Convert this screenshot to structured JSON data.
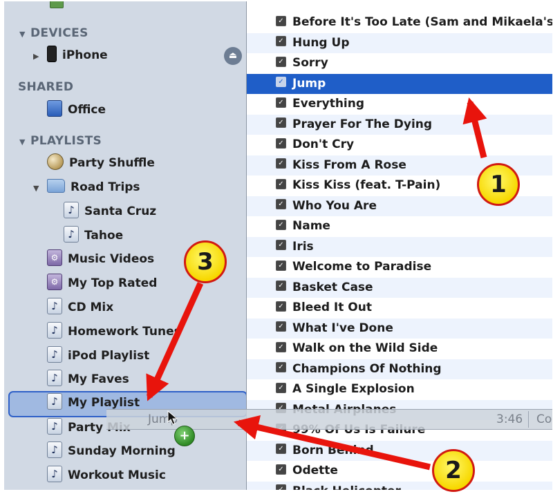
{
  "sidebar": {
    "devices_header": "DEVICES",
    "device": {
      "name": "iPhone",
      "icon": "iphone-icon",
      "eject_icon": "eject-icon"
    },
    "shared_header": "SHARED",
    "shared_item": {
      "label": "Office",
      "icon": "shared-library-icon"
    },
    "playlists_header": "PLAYLISTS",
    "playlists": [
      {
        "label": "Party Shuffle",
        "icon": "party-shuffle-icon"
      },
      {
        "label": "Road Trips",
        "icon": "folder-icon"
      },
      {
        "label": "Santa Cruz",
        "icon": "playlist-icon"
      },
      {
        "label": "Tahoe",
        "icon": "playlist-icon"
      },
      {
        "label": "Music Videos",
        "icon": "smart-playlist-icon"
      },
      {
        "label": "My Top Rated",
        "icon": "smart-playlist-icon"
      },
      {
        "label": "CD Mix",
        "icon": "playlist-icon"
      },
      {
        "label": "Homework Tunes",
        "icon": "playlist-icon"
      },
      {
        "label": "iPod Playlist",
        "icon": "playlist-icon"
      },
      {
        "label": "My Faves",
        "icon": "playlist-icon"
      },
      {
        "label": "My Playlist",
        "icon": "playlist-icon"
      },
      {
        "label": "Party Mix",
        "icon": "playlist-icon"
      },
      {
        "label": "Sunday Morning",
        "icon": "playlist-icon"
      },
      {
        "label": "Workout Music",
        "icon": "playlist-icon"
      }
    ]
  },
  "tracks": [
    "Before It's Too Late (Sam and Mikaela's T",
    "Hung Up",
    "Sorry",
    "Jump",
    "Everything",
    "Prayer For The Dying",
    "Don't Cry",
    "Kiss From A Rose",
    "Kiss Kiss (feat. T-Pain)",
    "Who You Are",
    "Name",
    "Iris",
    "Welcome to Paradise",
    "Basket Case",
    "Bleed It Out",
    "What I've Done",
    "Walk on the Wild Side",
    "Champions Of Nothing",
    "A Single Explosion",
    "Metal Airplanes",
    "99% Of Us Is Failure",
    "Born Behind",
    "Odette",
    "Black Helicopter"
  ],
  "selected_track": "Jump",
  "drag_ghost": {
    "name": "Jump",
    "time": "3:46",
    "extra": "Co"
  },
  "annotations": {
    "callout_1": "1",
    "callout_2": "2",
    "callout_3": "3"
  },
  "colors": {
    "selection": "#1f5ec8",
    "sidebar_bg": "#d1d9e4",
    "arrow": "#e8140c",
    "callout_fill": "#f7d800"
  }
}
